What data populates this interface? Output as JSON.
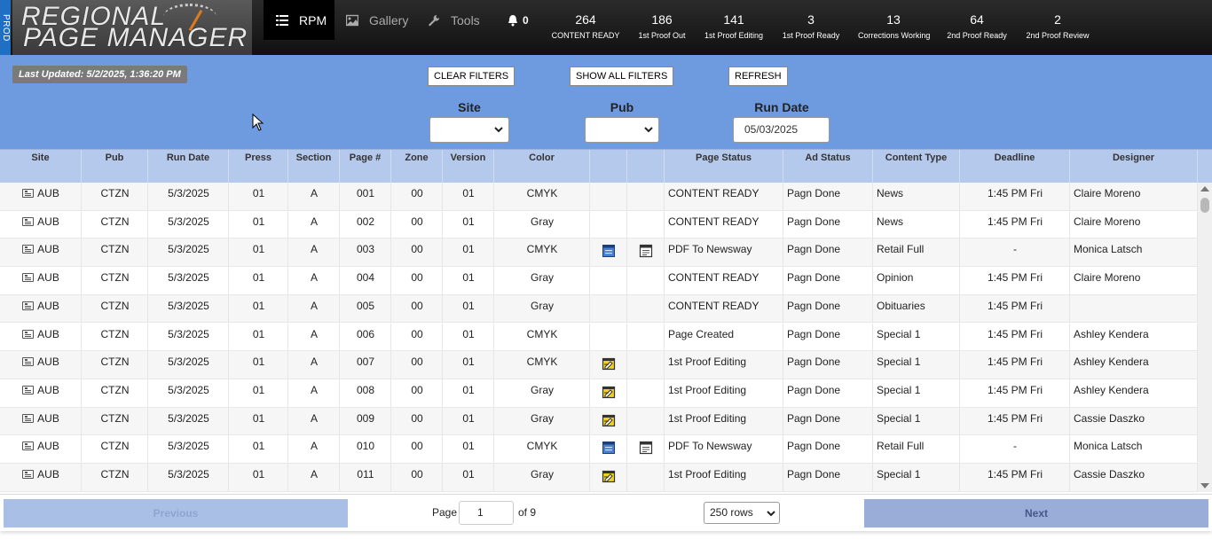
{
  "env_label": "PROD",
  "app": {
    "logo_line1": "REGIONAL",
    "logo_line2": "PAGE MANAGER"
  },
  "nav": {
    "rpm": "RPM",
    "gallery": "Gallery",
    "tools": "Tools",
    "notifications": "0"
  },
  "stats": [
    {
      "num": "264",
      "label": "CONTENT READY"
    },
    {
      "num": "186",
      "label": "1st Proof Out"
    },
    {
      "num": "141",
      "label": "1st Proof Editing"
    },
    {
      "num": "3",
      "label": "1st Proof Ready"
    },
    {
      "num": "13",
      "label": "Corrections Working"
    },
    {
      "num": "64",
      "label": "2nd Proof Ready"
    },
    {
      "num": "2",
      "label": "2nd Proof Review"
    }
  ],
  "filters": {
    "last_updated": "Last Updated: 5/2/2025, 1:36:20 PM",
    "clear": "CLEAR FILTERS",
    "show_all": "SHOW ALL FILTERS",
    "refresh": "REFRESH",
    "site_label": "Site",
    "pub_label": "Pub",
    "run_date_label": "Run Date",
    "run_date_value": "05/03/2025"
  },
  "table": {
    "headers": [
      "Site",
      "Pub",
      "Run Date",
      "Press",
      "Section",
      "Page #",
      "Zone",
      "Version",
      "Color",
      "",
      "",
      "Page Status",
      "Ad Status",
      "Content Type",
      "Deadline",
      "Designer"
    ],
    "rows": [
      {
        "site": "AUB",
        "pub": "CTZN",
        "run_date": "5/3/2025",
        "press": "01",
        "section": "A",
        "page": "001",
        "zone": "00",
        "version": "01",
        "color": "CMYK",
        "icon1": "",
        "icon2": "",
        "status": "CONTENT READY",
        "ad_status": "Pagn Done",
        "content_type": "News",
        "deadline": "1:45 PM Fri",
        "designer": "Claire Moreno"
      },
      {
        "site": "AUB",
        "pub": "CTZN",
        "run_date": "5/3/2025",
        "press": "01",
        "section": "A",
        "page": "002",
        "zone": "00",
        "version": "01",
        "color": "Gray",
        "icon1": "",
        "icon2": "",
        "status": "CONTENT READY",
        "ad_status": "Pagn Done",
        "content_type": "News",
        "deadline": "1:45 PM Fri",
        "designer": "Claire Moreno"
      },
      {
        "site": "AUB",
        "pub": "CTZN",
        "run_date": "5/3/2025",
        "press": "01",
        "section": "A",
        "page": "003",
        "zone": "00",
        "version": "01",
        "color": "CMYK",
        "icon1": "blue-page-icon",
        "icon2": "newspaper-icon",
        "status": "PDF To Newsway",
        "ad_status": "Pagn Done",
        "content_type": "Retail Full",
        "deadline": "-",
        "designer": "Monica Latsch"
      },
      {
        "site": "AUB",
        "pub": "CTZN",
        "run_date": "5/3/2025",
        "press": "01",
        "section": "A",
        "page": "004",
        "zone": "00",
        "version": "01",
        "color": "Gray",
        "icon1": "",
        "icon2": "",
        "status": "CONTENT READY",
        "ad_status": "Pagn Done",
        "content_type": "Opinion",
        "deadline": "1:45 PM Fri",
        "designer": "Claire Moreno"
      },
      {
        "site": "AUB",
        "pub": "CTZN",
        "run_date": "5/3/2025",
        "press": "01",
        "section": "A",
        "page": "005",
        "zone": "00",
        "version": "01",
        "color": "Gray",
        "icon1": "",
        "icon2": "",
        "status": "CONTENT READY",
        "ad_status": "Pagn Done",
        "content_type": "Obituaries",
        "deadline": "1:45 PM Fri",
        "designer": ""
      },
      {
        "site": "AUB",
        "pub": "CTZN",
        "run_date": "5/3/2025",
        "press": "01",
        "section": "A",
        "page": "006",
        "zone": "00",
        "version": "01",
        "color": "CMYK",
        "icon1": "",
        "icon2": "",
        "status": "Page Created",
        "ad_status": "Pagn Done",
        "content_type": "Special 1",
        "deadline": "1:45 PM Fri",
        "designer": "Ashley Kendera"
      },
      {
        "site": "AUB",
        "pub": "CTZN",
        "run_date": "5/3/2025",
        "press": "01",
        "section": "A",
        "page": "007",
        "zone": "00",
        "version": "01",
        "color": "CMYK",
        "icon1": "yellow-edit-icon",
        "icon2": "",
        "status": "1st Proof Editing",
        "ad_status": "Pagn Done",
        "content_type": "Special 1",
        "deadline": "1:45 PM Fri",
        "designer": "Ashley Kendera"
      },
      {
        "site": "AUB",
        "pub": "CTZN",
        "run_date": "5/3/2025",
        "press": "01",
        "section": "A",
        "page": "008",
        "zone": "00",
        "version": "01",
        "color": "Gray",
        "icon1": "yellow-edit-icon",
        "icon2": "",
        "status": "1st Proof Editing",
        "ad_status": "Pagn Done",
        "content_type": "Special 1",
        "deadline": "1:45 PM Fri",
        "designer": "Ashley Kendera"
      },
      {
        "site": "AUB",
        "pub": "CTZN",
        "run_date": "5/3/2025",
        "press": "01",
        "section": "A",
        "page": "009",
        "zone": "00",
        "version": "01",
        "color": "Gray",
        "icon1": "yellow-edit-icon",
        "icon2": "",
        "status": "1st Proof Editing",
        "ad_status": "Pagn Done",
        "content_type": "Special 1",
        "deadline": "1:45 PM Fri",
        "designer": "Cassie Daszko"
      },
      {
        "site": "AUB",
        "pub": "CTZN",
        "run_date": "5/3/2025",
        "press": "01",
        "section": "A",
        "page": "010",
        "zone": "00",
        "version": "01",
        "color": "CMYK",
        "icon1": "blue-page-icon",
        "icon2": "newspaper-icon",
        "status": "PDF To Newsway",
        "ad_status": "Pagn Done",
        "content_type": "Retail Full",
        "deadline": "-",
        "designer": "Monica Latsch"
      },
      {
        "site": "AUB",
        "pub": "CTZN",
        "run_date": "5/3/2025",
        "press": "01",
        "section": "A",
        "page": "011",
        "zone": "00",
        "version": "01",
        "color": "Gray",
        "icon1": "yellow-edit-icon",
        "icon2": "",
        "status": "1st Proof Editing",
        "ad_status": "Pagn Done",
        "content_type": "Special 1",
        "deadline": "1:45 PM Fri",
        "designer": "Cassie Daszko"
      }
    ]
  },
  "pager": {
    "previous": "Previous",
    "next": "Next",
    "page_label": "Page",
    "page_value": "1",
    "of_label": "of 9",
    "rows_option": "250 rows"
  },
  "colors": {
    "topbar": "#1a1a1a",
    "filter_bg": "#6e9ae0",
    "header_bg": "#b5c9ec",
    "prod_tab": "#1f6fc5"
  }
}
